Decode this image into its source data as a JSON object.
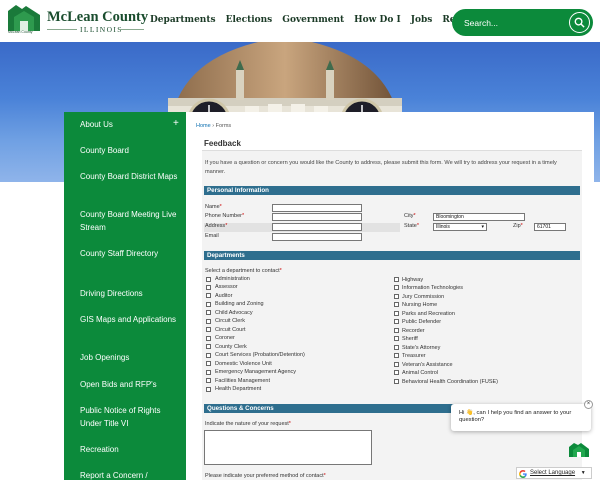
{
  "header": {
    "logo_title": "McLean County",
    "logo_sub": "ILLINOIS",
    "logo_tiny": "McLean County",
    "nav": [
      "Departments",
      "Elections",
      "Government",
      "How Do I",
      "Jobs",
      "Residents"
    ],
    "search_placeholder": "Search..."
  },
  "sidebar": {
    "items": [
      "About Us",
      "County Board",
      "County Board District Maps",
      "County Board Meeting Live Stream",
      "County Staff Directory",
      "Driving Directions",
      "GIS Maps and Applications",
      "Job Openings",
      "Open Bids and RFP's",
      "Public Notice of Rights Under Title VI",
      "Recreation",
      "Report a Concern /"
    ],
    "plus": "+"
  },
  "content": {
    "breadcrumb_home": "Home",
    "breadcrumb_sep": "›",
    "breadcrumb_current": "Forms",
    "page_title": "Feedback",
    "intro": "If you have a question or concern you would like the County to address, please submit this form. We will try to address your request in a timely manner.",
    "personal": {
      "heading": "Personal Information",
      "name_label": "Name",
      "phone_label": "Phone Number",
      "address_label": "Address",
      "email_label": "Email",
      "city_label": "City",
      "city_value": "Bloomington",
      "state_label": "State",
      "state_value": "Illinois",
      "zip_label": "Zip",
      "zip_value": "61701",
      "required_mark": "*"
    },
    "departments": {
      "heading": "Departments",
      "prompt": "Select a department to contact",
      "left": [
        "Administration",
        "Assessor",
        "Auditor",
        "Building and Zoning",
        "Child Advocacy",
        "Circuit Clerk",
        "Circuit Court",
        "Coroner",
        "County Clerk",
        "Court Services (Probation/Detention)",
        "Domestic Violence Unit",
        "Emergency Management Agency",
        "Facilities Management",
        "Health Department"
      ],
      "right": [
        "Highway",
        "Information Technologies",
        "Jury Commission",
        "Nursing Home",
        "Parks and Recreation",
        "Public Defender",
        "Recorder",
        "Sheriff",
        "State's Attorney",
        "Treasurer",
        "Veteran's Assistance",
        "Animal Control",
        "Behavioral Health Coordination (FUSE)"
      ]
    },
    "questions": {
      "heading": "Questions & Concerns",
      "nature_label": "Indicate the nature of your request",
      "method_label": "Please indicate your preferred method of contact"
    }
  },
  "chat": {
    "message": "Hi 👋, can I help you find an answer to your question?",
    "close": "×"
  },
  "translate": {
    "label": "Select Language",
    "arrow": "▼"
  },
  "colors": {
    "brand_green": "#0c8a3b",
    "section_blue": "#2e6e8e",
    "logo_green": "#1a4d2e"
  }
}
